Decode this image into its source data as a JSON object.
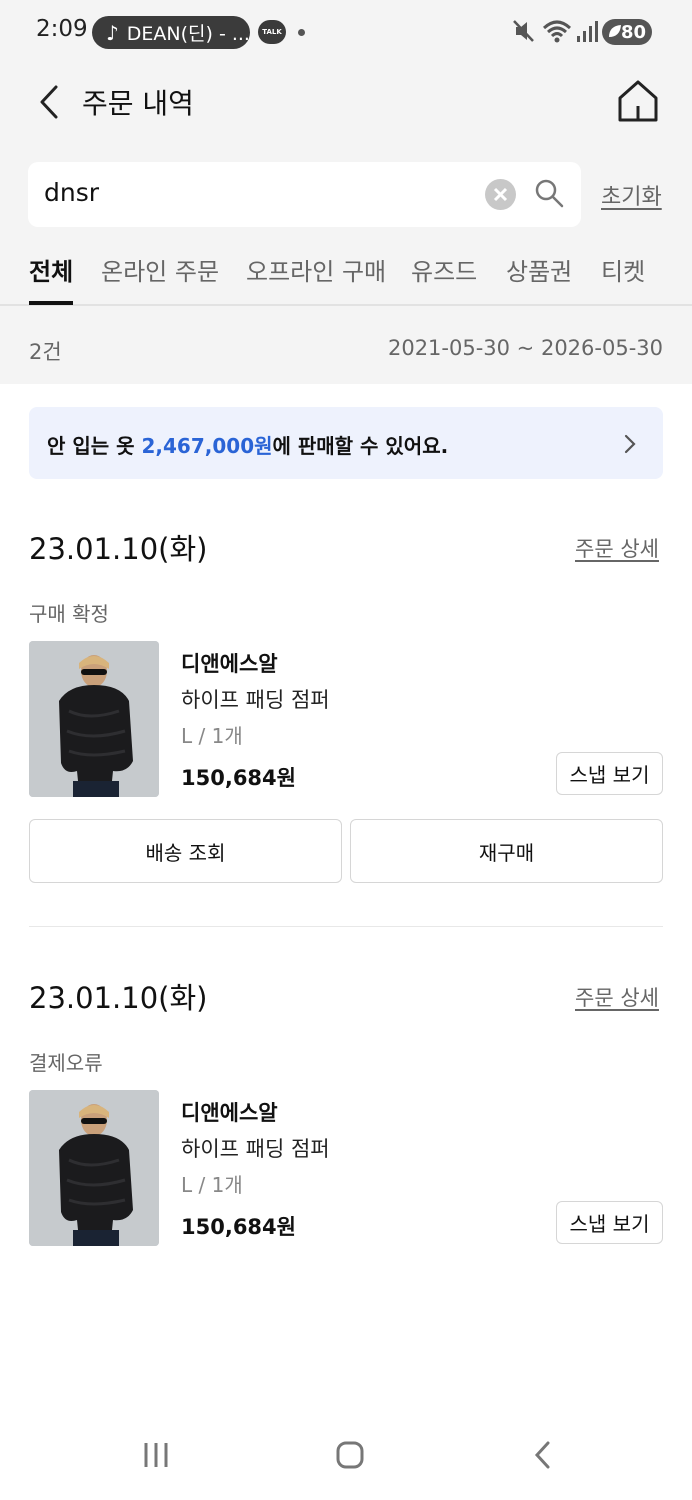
{
  "status_bar": {
    "time": "2:09",
    "music_text": "DEAN(딘) - ...",
    "talk_badge": "TALK",
    "battery": "80"
  },
  "header": {
    "title": "주문 내역",
    "back_icon": "chevron-left-icon",
    "home_icon": "home-icon"
  },
  "search": {
    "value": "dnsr",
    "reset_label": "초기화"
  },
  "tabs": [
    {
      "label": "전체",
      "active": true
    },
    {
      "label": "온라인 주문"
    },
    {
      "label": "오프라인 구매"
    },
    {
      "label": "유즈드"
    },
    {
      "label": "상품권"
    },
    {
      "label": "티켓"
    }
  ],
  "summary": {
    "count": "2건",
    "date_range": "2021-05-30 ~ 2026-05-30"
  },
  "banner": {
    "prefix": "안 입는 옷 ",
    "amount": "2,467,000원",
    "suffix": "에 판매할 수 있어요.",
    "accent_color": "#2a64d6"
  },
  "orders": [
    {
      "date": "23.01.10(화)",
      "detail_label": "주문 상세",
      "status": "구매 확정",
      "brand": "디앤에스알",
      "product_name": "하이프 패딩 점퍼",
      "option": "L / 1개",
      "price": "150,684원",
      "snap_label": "스냅 보기",
      "actions": [
        "배송 조회",
        "재구매"
      ]
    },
    {
      "date": "23.01.10(화)",
      "detail_label": "주문 상세",
      "status": "결제오류",
      "brand": "디앤에스알",
      "product_name": "하이프 패딩 점퍼",
      "option": "L / 1개",
      "price": "150,684원",
      "snap_label": "스냅 보기"
    }
  ]
}
